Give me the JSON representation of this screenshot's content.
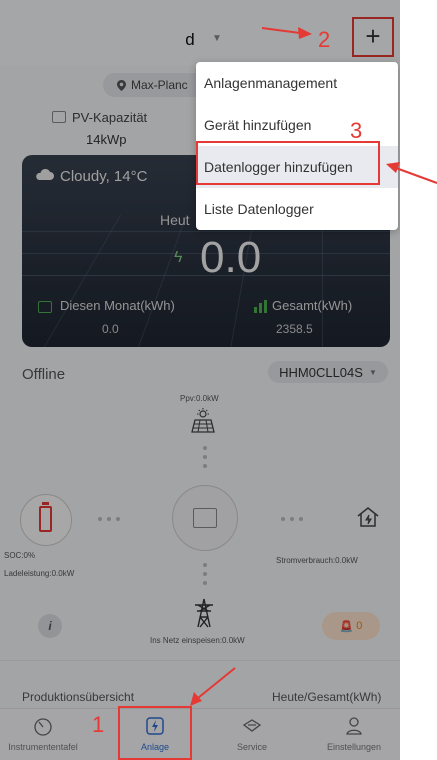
{
  "header": {
    "plant_name": "d",
    "plant_chevron": "▼",
    "add_label": "+"
  },
  "plant": {
    "location": "Max-Planc",
    "pv_label": "PV-Kapazität",
    "pv_value": "14kWp"
  },
  "weather_card": {
    "weather": "Cloudy,  14°C",
    "today_label": "Heut",
    "today_value": "0.0",
    "month_label": "Diesen Monat(kWh)",
    "month_value": "0.0",
    "total_label": "Gesamt(kWh)",
    "total_value": "2358.5"
  },
  "status": {
    "text": "Offline",
    "device": "HHM0CLL04S"
  },
  "energy_flow": {
    "ppv": "Ppv:0.0kW",
    "soc": "SOC:0%",
    "ladeleistung": "Ladeleistung:0.0kW",
    "stromverbrauch": "Stromverbrauch:0.0kW",
    "netz": "Ins Netz einspeisen:0.0kW",
    "info": "i",
    "alarm_count": "0"
  },
  "production": {
    "label": "Produktionsübersicht",
    "right": "Heute/Gesamt(kWh)"
  },
  "tabs": [
    {
      "label": "Instrumententafel"
    },
    {
      "label": "Anlage"
    },
    {
      "label": "Service"
    },
    {
      "label": "Einstellungen"
    }
  ],
  "menu": {
    "items": [
      {
        "label": "Anlagenmanagement"
      },
      {
        "label": "Gerät hinzufügen"
      },
      {
        "label": "Datenlogger hinzufügen"
      },
      {
        "label": "Liste Datenlogger"
      }
    ]
  },
  "annotations": {
    "step1": "1",
    "step2": "2",
    "step3": "3"
  },
  "colors": {
    "accent": "#2f6fd1",
    "annotation": "#e53935",
    "alarm": "#e67e22",
    "battery_low": "#e53935"
  },
  "icons": [
    "location-pin-icon",
    "solar-panel-icon",
    "cloud-icon",
    "bolt-icon",
    "battery-icon",
    "inverter-icon",
    "home-icon",
    "pylon-icon",
    "alarm-icon",
    "dashboard-icon",
    "plant-icon",
    "service-icon",
    "settings-icon"
  ]
}
